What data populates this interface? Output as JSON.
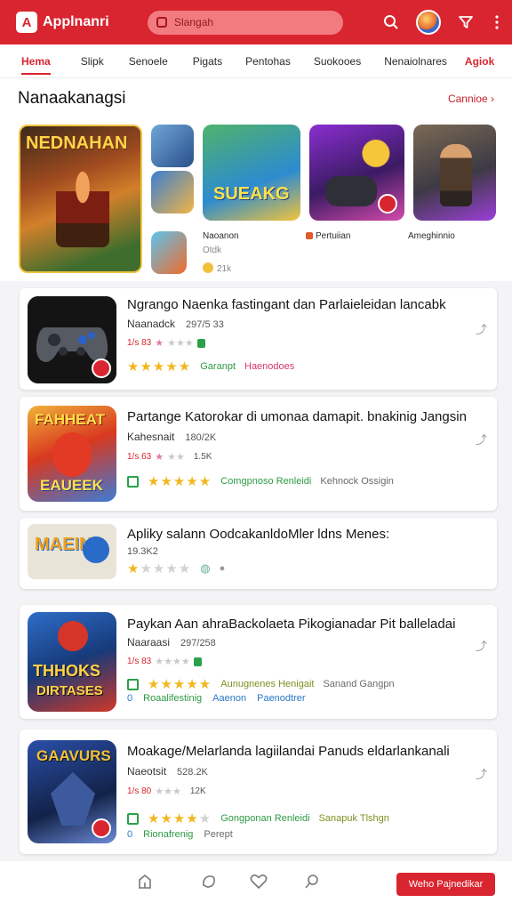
{
  "app": {
    "logo_text": "Applnanri",
    "logo_letter": "A"
  },
  "search": {
    "placeholder": "Slangah"
  },
  "tabs": [
    "Hema",
    "Slipk",
    "Senoele",
    "Pigats",
    "Pentohas",
    "Suokooes",
    "Nenaiolnares",
    "Agiok"
  ],
  "featured": {
    "title": "Nanaakanagsi",
    "more": "Cannioe ›",
    "big_tile_title": "NEDNAHAN",
    "tile_m1_title": "SUEAKG",
    "captions": {
      "m1_name": "Naoanon",
      "m1_sub": "Otdk",
      "m1_count": "21k",
      "m2_name": "Pertuiian",
      "m3_name": "Ameghinnio"
    }
  },
  "list": [
    {
      "title": "Ngrango Naenka fastingant dan Parlaieleidan lancabk",
      "dev": "Naanadck",
      "num": "297/5 33",
      "meta": "1/s 83",
      "tags": [
        "Garanpt",
        "Haenodoes"
      ]
    },
    {
      "title": "Partange Katorokar di umonaa damapit. bnakinig Jangsin",
      "dev": "Kahesnait",
      "num": "180/2K",
      "meta": "1/s 63",
      "meta2": "1.5K",
      "tags": [
        "Comgpnoso Renleidi",
        "Kehnock Ossigin"
      ]
    },
    {
      "title": "Apliky salann OodcakanldoMler ldns Menes:",
      "dev": "19.3K2"
    },
    {
      "title": "Paykan Aan ahraBackolaeta Pikogianadar Pit balleladai",
      "dev": "Naaraasi",
      "num": "297/258",
      "meta": "1/s 83",
      "tags": [
        "Aunugnenes Henigait",
        "Sanand Gangpn"
      ],
      "tags2": [
        "0",
        "Roaalifestinig",
        "Aaenon",
        "Paenodtrer"
      ]
    },
    {
      "title": "Moakage/Melarlanda lagiilandai Panuds eldarlankanali",
      "dev": "Naeotsit",
      "num": "528.2K",
      "meta": "1/s 80",
      "meta2": "12K",
      "tags": [
        "Gongponan Renleidi",
        "Sanapuk Tlshgn"
      ],
      "tags2": [
        "0",
        "Rionafrenig",
        "Perept"
      ]
    }
  ],
  "bottom": {
    "cta": "Weho Pajnedikar"
  },
  "colors": {
    "brand_red": "#d9252f",
    "star_gold": "#f2b71e",
    "tag_green": "#2f9a45"
  }
}
